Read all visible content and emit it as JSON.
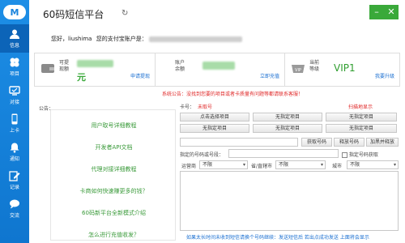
{
  "app": {
    "title": "60码短信平台",
    "logo_text": "M"
  },
  "sidebar": {
    "items": [
      {
        "label": "信息",
        "icon": "user-icon"
      },
      {
        "label": "项目",
        "icon": "clover-icon"
      },
      {
        "label": "对接",
        "icon": "connect-icon"
      },
      {
        "label": "上卡",
        "icon": "phone-icon"
      },
      {
        "label": "通知",
        "icon": "bell-icon"
      },
      {
        "label": "记录",
        "icon": "edit-icon"
      },
      {
        "label": "交流",
        "icon": "chat-icon"
      }
    ]
  },
  "greeting": {
    "prefix": "您好，",
    "username": "liushima",
    "account_label": "您的支付宝账户是："
  },
  "panels": {
    "withdraw": {
      "label1": "可提",
      "label2": "现额",
      "unit": "元",
      "link": "申请提现"
    },
    "balance": {
      "label1": "账户",
      "label2": "余额",
      "link": "立即充值"
    },
    "vip": {
      "label1": "当前",
      "label2": "等级",
      "level": "VIP1",
      "link": "我要升级"
    }
  },
  "notice": "系统公告：没找到您要的项目或者卡质量有问题等都请联系客服！",
  "left": {
    "label": "公告：",
    "links": [
      "用户取号详细教程",
      "开发者API文档",
      "代理对接详细教程",
      "卡商如何快速赚更多的钱？",
      "60码新平台全新模式介绍",
      "怎么进行充值收发？"
    ]
  },
  "right": {
    "card_label": "卡号：",
    "card_value": "未取号",
    "countdown": "扫描地显示",
    "project_buttons": [
      "点击选择项目",
      "无指定项目",
      "无指定项目",
      "无指定项目",
      "无指定项目",
      "无指定项目"
    ],
    "actions": {
      "get": "获取号码",
      "release": "释放号码",
      "blacklist": "加黑并释放"
    },
    "specify_label": "指定的号码或号段：",
    "specify_check": "指定号码获取",
    "filters": [
      {
        "label": "运营商",
        "value": "不限"
      },
      {
        "label": "省/直辖市",
        "value": "不限"
      },
      {
        "label": "城市",
        "value": "不限"
      }
    ],
    "footer": "如果太长时间未收到短信请换个号码继续：发送短信后 若出点成功发送 上面将会显示"
  }
}
